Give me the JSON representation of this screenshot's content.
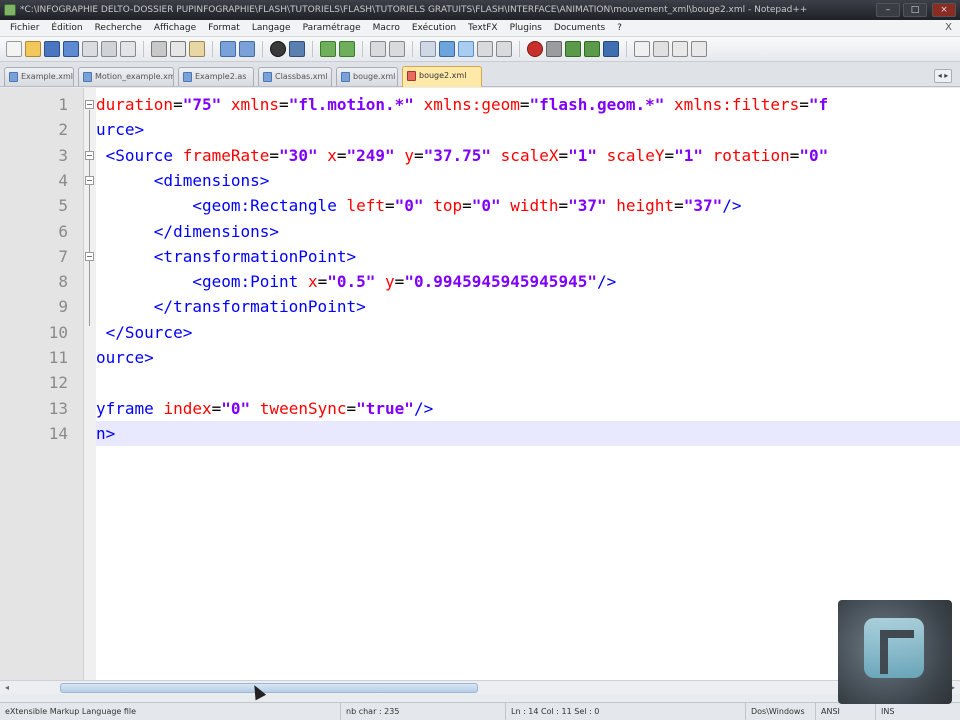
{
  "window": {
    "title": "*C:\\INFOGRAPHIE DELTO-DOSSIER PUPINFOGRAPHIE\\FLASH\\TUTORIELS\\FLASH\\TUTORIELS GRATUITS\\FLASH\\INTERFACE\\ANIMATION\\mouvement_xml\\bouge2.xml - Notepad++",
    "minimize": "–",
    "maximize": "□",
    "close": "×"
  },
  "menu": [
    "Fichier",
    "Édition",
    "Recherche",
    "Affichage",
    "Format",
    "Langage",
    "Paramétrage",
    "Macro",
    "Exécution",
    "TextFX",
    "Plugins",
    "Documents",
    "?"
  ],
  "menu_close": "X",
  "tabs": [
    {
      "label": "Example.xml",
      "active": false
    },
    {
      "label": "Motion_example.xml",
      "active": false
    },
    {
      "label": "Example2.as",
      "active": false
    },
    {
      "label": "Classbas.xml",
      "active": false
    },
    {
      "label": "bouge.xml",
      "active": false
    },
    {
      "label": "bouge2.xml",
      "active": true
    }
  ],
  "tab_scroll": "◂ ▸",
  "editor": {
    "lines": [
      {
        "num": "1",
        "fold": true,
        "tokens": [
          [
            "attr",
            "duration"
          ],
          [
            "eq",
            "="
          ],
          [
            "val",
            "\"75\""
          ],
          [
            "eq",
            " "
          ],
          [
            "attr",
            "xmlns"
          ],
          [
            "eq",
            "="
          ],
          [
            "val",
            "\"fl.motion.*\""
          ],
          [
            "eq",
            " "
          ],
          [
            "attr",
            "xmlns:geom"
          ],
          [
            "eq",
            "="
          ],
          [
            "val",
            "\"flash.geom.*\""
          ],
          [
            "eq",
            " "
          ],
          [
            "attr",
            "xmlns:filters"
          ],
          [
            "eq",
            "="
          ],
          [
            "val",
            "\"f"
          ]
        ]
      },
      {
        "num": "2",
        "fold": false,
        "tokens": [
          [
            "tag",
            "urce>"
          ]
        ]
      },
      {
        "num": "3",
        "fold": true,
        "tokens": [
          [
            "tag",
            " <Source"
          ],
          [
            "eq",
            " "
          ],
          [
            "attr",
            "frameRate"
          ],
          [
            "eq",
            "="
          ],
          [
            "val",
            "\"30\""
          ],
          [
            "eq",
            " "
          ],
          [
            "attr",
            "x"
          ],
          [
            "eq",
            "="
          ],
          [
            "val",
            "\"249\""
          ],
          [
            "eq",
            " "
          ],
          [
            "attr",
            "y"
          ],
          [
            "eq",
            "="
          ],
          [
            "val",
            "\"37.75\""
          ],
          [
            "eq",
            " "
          ],
          [
            "attr",
            "scaleX"
          ],
          [
            "eq",
            "="
          ],
          [
            "val",
            "\"1\""
          ],
          [
            "eq",
            " "
          ],
          [
            "attr",
            "scaleY"
          ],
          [
            "eq",
            "="
          ],
          [
            "val",
            "\"1\""
          ],
          [
            "eq",
            " "
          ],
          [
            "attr",
            "rotation"
          ],
          [
            "eq",
            "="
          ],
          [
            "val",
            "\"0\""
          ]
        ]
      },
      {
        "num": "4",
        "fold": true,
        "tokens": [
          [
            "tag",
            "      <dimensions>"
          ]
        ]
      },
      {
        "num": "5",
        "fold": false,
        "tokens": [
          [
            "tag",
            "          <geom:Rectangle"
          ],
          [
            "eq",
            " "
          ],
          [
            "attr",
            "left"
          ],
          [
            "eq",
            "="
          ],
          [
            "val",
            "\"0\""
          ],
          [
            "eq",
            " "
          ],
          [
            "attr",
            "top"
          ],
          [
            "eq",
            "="
          ],
          [
            "val",
            "\"0\""
          ],
          [
            "eq",
            " "
          ],
          [
            "attr",
            "width"
          ],
          [
            "eq",
            "="
          ],
          [
            "val",
            "\"37\""
          ],
          [
            "eq",
            " "
          ],
          [
            "attr",
            "height"
          ],
          [
            "eq",
            "="
          ],
          [
            "val",
            "\"37\""
          ],
          [
            "tag",
            "/>"
          ]
        ]
      },
      {
        "num": "6",
        "fold": false,
        "tokens": [
          [
            "tag",
            "      </dimensions>"
          ]
        ]
      },
      {
        "num": "7",
        "fold": true,
        "tokens": [
          [
            "tag",
            "      <transformationPoint>"
          ]
        ]
      },
      {
        "num": "8",
        "fold": false,
        "tokens": [
          [
            "tag",
            "          <geom:Point"
          ],
          [
            "eq",
            " "
          ],
          [
            "attr",
            "x"
          ],
          [
            "eq",
            "="
          ],
          [
            "val",
            "\"0.5\""
          ],
          [
            "eq",
            " "
          ],
          [
            "attr",
            "y"
          ],
          [
            "eq",
            "="
          ],
          [
            "val",
            "\"0.9945945945945945\""
          ],
          [
            "tag",
            "/>"
          ]
        ]
      },
      {
        "num": "9",
        "fold": false,
        "tokens": [
          [
            "tag",
            "      </transformationPoint>"
          ]
        ]
      },
      {
        "num": "10",
        "fold": false,
        "tokens": [
          [
            "tag",
            " </Source>"
          ]
        ]
      },
      {
        "num": "11",
        "fold": false,
        "tokens": [
          [
            "tag",
            "ource>"
          ]
        ]
      },
      {
        "num": "12",
        "fold": false,
        "tokens": []
      },
      {
        "num": "13",
        "fold": false,
        "tokens": [
          [
            "tag",
            "yframe"
          ],
          [
            "eq",
            " "
          ],
          [
            "attr",
            "index"
          ],
          [
            "eq",
            "="
          ],
          [
            "val",
            "\"0\""
          ],
          [
            "eq",
            " "
          ],
          [
            "attr",
            "tweenSync"
          ],
          [
            "eq",
            "="
          ],
          [
            "val",
            "\"true\""
          ],
          [
            "tag",
            "/>"
          ]
        ]
      },
      {
        "num": "14",
        "fold": false,
        "current": true,
        "tokens": [
          [
            "tag",
            "n>"
          ]
        ]
      }
    ]
  },
  "statusbar": {
    "language": "eXtensible Markup Language file",
    "length": "nb char : 235",
    "position": "Ln : 14   Col : 11   Sel : 0",
    "eol": "Dos\\Windows",
    "encoding": "ANSI",
    "mode": "INS"
  },
  "colors": {
    "tag": "#0000ff",
    "attribute": "#ff0000",
    "value": "#8000ff",
    "current_line": "#e8e8ff",
    "active_tab": "#ffe9a8"
  }
}
